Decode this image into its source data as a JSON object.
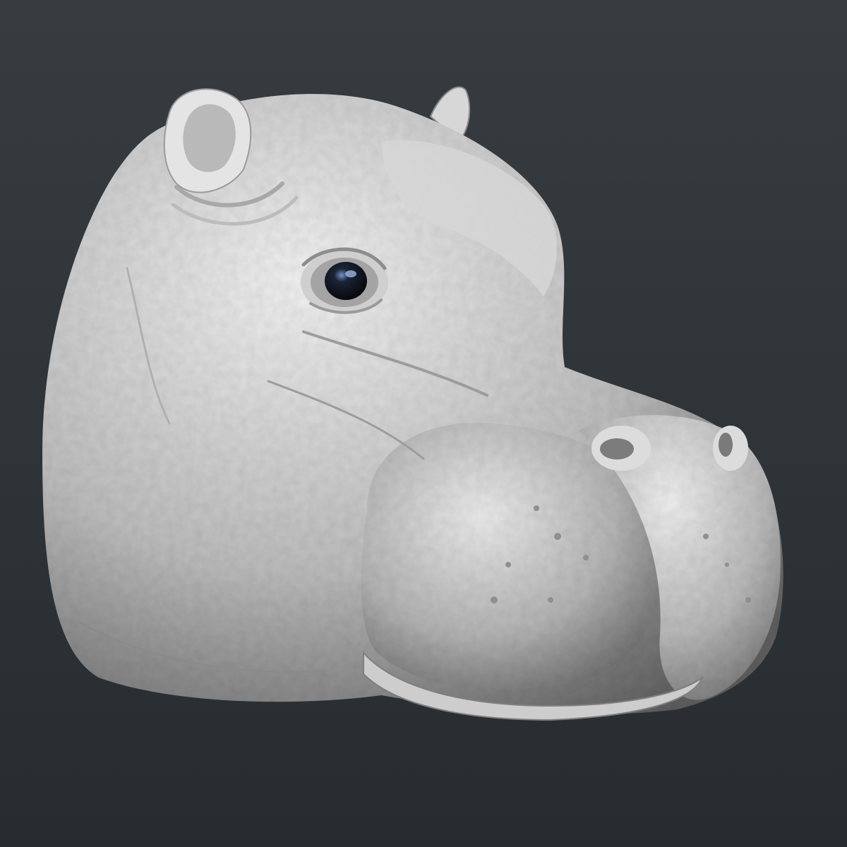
{
  "scene": {
    "subject": "hippo-head-sculpt",
    "colors": {
      "background_top": "#363c40",
      "background_bottom": "#272c30",
      "clay_light": "#f2f2f2",
      "clay_mid": "#bdbdbd",
      "clay_dark": "#5e5e5e",
      "eye": "#050608",
      "eye_highlight": "#6f93c9"
    }
  }
}
